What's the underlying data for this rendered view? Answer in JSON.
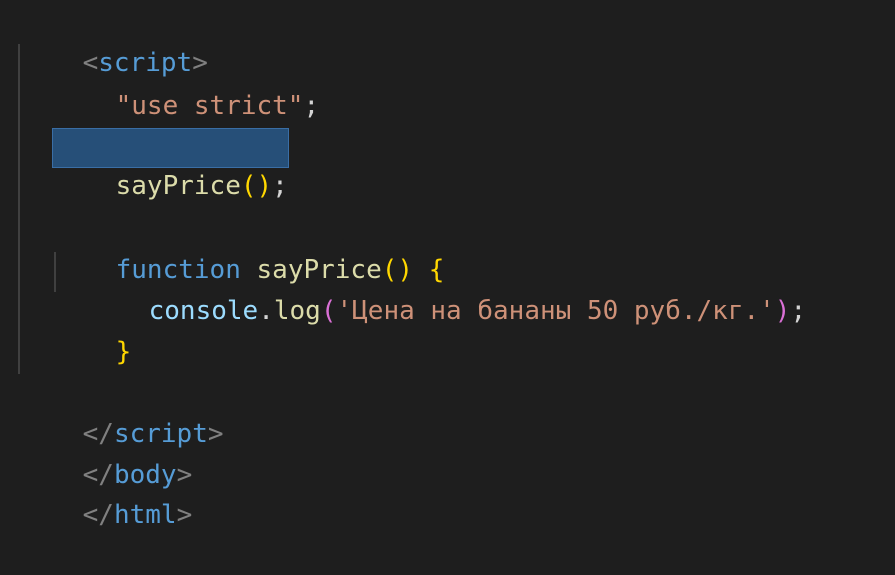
{
  "colors": {
    "background": "#1e1e1e",
    "tag_bracket": "#808080",
    "tag_name": "#569cd6",
    "keyword": "#569cd6",
    "function_name": "#dcdcaa",
    "string": "#ce9178",
    "variable": "#9cdcfe",
    "bracket": "#ffd700",
    "bracket_inner": "#da70d6",
    "punctuation": "#d4d4d4",
    "selection": "#264f78"
  },
  "code": {
    "line1": {
      "open": "<",
      "tag": "script",
      "close": ">"
    },
    "line2": {
      "directive": "\"use strict\"",
      "semicolon": ";"
    },
    "line3": {
      "call": "sayPrice",
      "open_paren": "(",
      "close_paren": ")",
      "semicolon": ";"
    },
    "line4": {
      "keyword": "function",
      "space": " ",
      "name": "sayPrice",
      "parens": "()",
      "space2": " ",
      "brace": "{"
    },
    "line5": {
      "object": "console",
      "dot": ".",
      "method": "log",
      "open_paren": "(",
      "string": "'Цена на бананы 50 руб./кг.'",
      "close_paren": ")",
      "semicolon": ";"
    },
    "line6": {
      "brace": "}"
    },
    "line7": {
      "open": "</",
      "tag": "script",
      "close": ">"
    },
    "line8": {
      "open": "</",
      "tag": "body",
      "close": ">"
    },
    "line9": {
      "open": "</",
      "tag": "html",
      "close": ">"
    }
  }
}
